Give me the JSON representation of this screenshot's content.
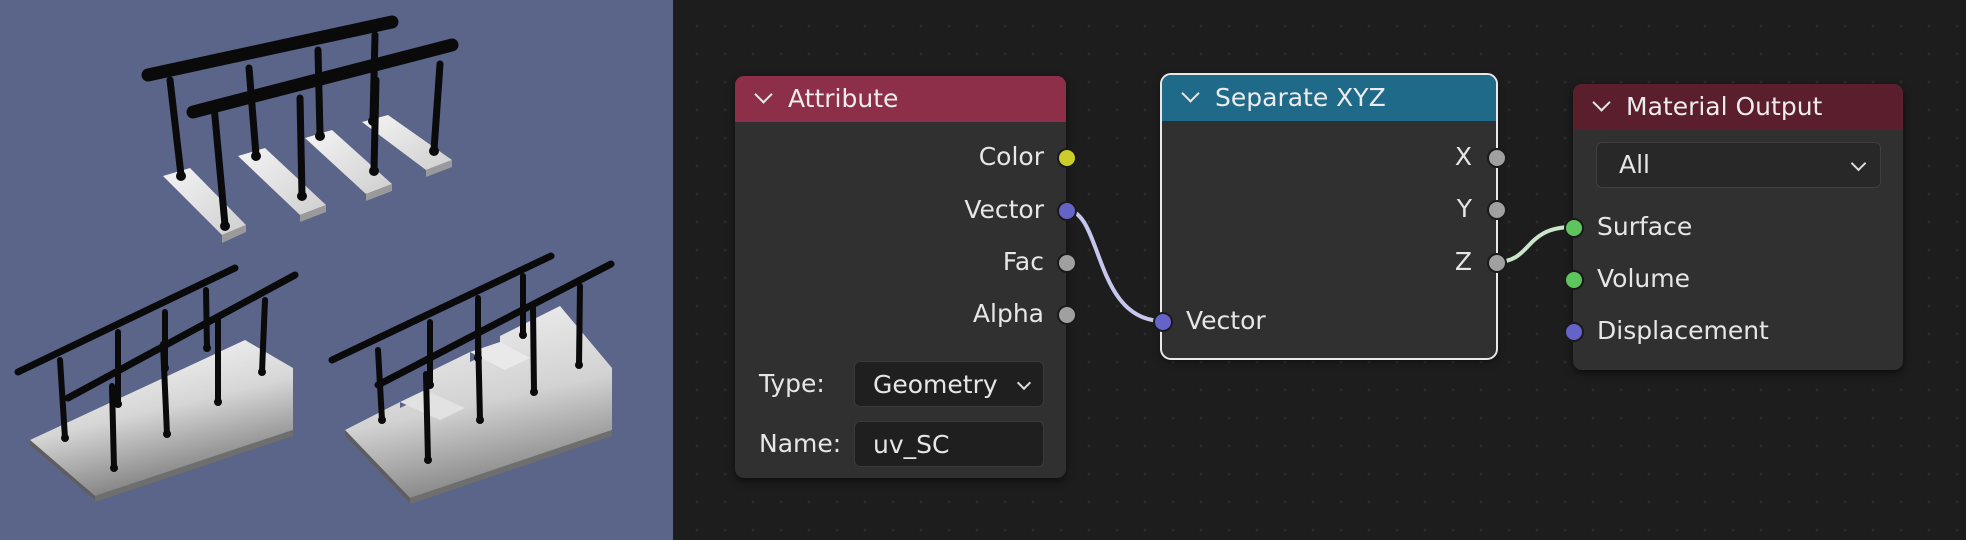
{
  "nodes": {
    "attribute": {
      "title": "Attribute",
      "header_color": "#8e2f4a",
      "outputs": [
        "Color",
        "Vector",
        "Fac",
        "Alpha"
      ],
      "type_label": "Type:",
      "type_value": "Geometry",
      "name_label": "Name:",
      "name_value": "uv_SC"
    },
    "separate_xyz": {
      "title": "Separate XYZ",
      "header_color": "#1f6a88",
      "outputs": [
        "X",
        "Y",
        "Z"
      ],
      "input": "Vector"
    },
    "material_output": {
      "title": "Material Output",
      "header_color": "#5a1e2c",
      "target_value": "All",
      "inputs": [
        "Surface",
        "Volume",
        "Displacement"
      ]
    }
  },
  "colors": {
    "viewport_bg": "#5b6489",
    "editor_bg": "#1d1d1d",
    "socket_color": "#cdcd2a",
    "socket_vector": "#6363c8",
    "socket_float": "#a0a0a0",
    "socket_shader": "#5ec55e"
  },
  "icons": [
    "chevron-down-icon",
    "dropdown-arrow-icon"
  ]
}
